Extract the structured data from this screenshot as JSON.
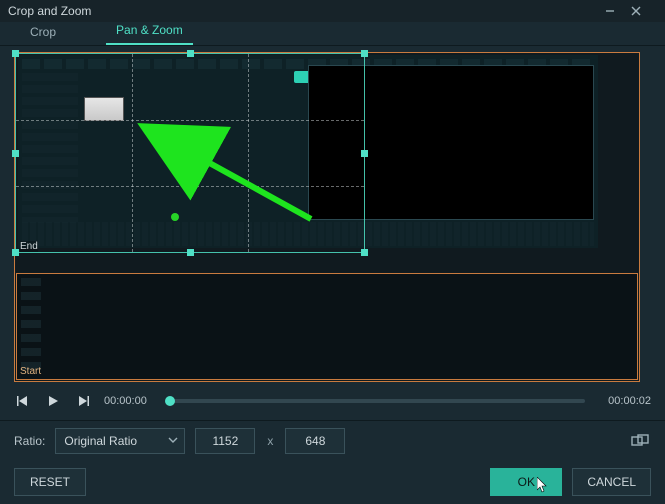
{
  "window": {
    "title": "Crop and Zoom"
  },
  "tabs": {
    "crop": "Crop",
    "panzoom": "Pan & Zoom",
    "active": "panzoom"
  },
  "crop": {
    "end_label": "End"
  },
  "start": {
    "label": "Start"
  },
  "playback": {
    "current": "00:00:00",
    "total": "00:00:02",
    "position_pct": 0
  },
  "ratio": {
    "label": "Ratio:",
    "selected": "Original Ratio",
    "width": "1152",
    "sep": "x",
    "height": "648"
  },
  "buttons": {
    "reset": "RESET",
    "ok": "OK",
    "cancel": "CANCEL"
  }
}
